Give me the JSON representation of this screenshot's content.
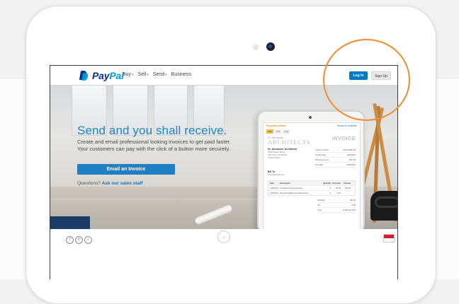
{
  "nav": {
    "logo_pay": "Pay",
    "logo_pal": "Pal",
    "links": [
      {
        "label": "Buy"
      },
      {
        "label": "Sell"
      },
      {
        "label": "Send"
      },
      {
        "label": "Business"
      }
    ],
    "login": "Log In",
    "signup": "Sign Up"
  },
  "hero": {
    "headline": "Send and you shall receive.",
    "sub1": "Create and email professional looking invoices to get paid faster.",
    "sub2": "Your customers can pay with the click of a button more securely.",
    "cta": "Email an Invoice",
    "questions": "Questions?",
    "questions_link": "Ask our sales staff"
  },
  "invoice": {
    "preview": "Preview Invoice",
    "save": "Saved Complete",
    "tabs": [
      "Web",
      "iOS",
      "iPad"
    ],
    "brand_small": "St. Alexander",
    "brand_big": "ARCHITECTS",
    "word": "INVOICE",
    "from_name": "St. Alexander Architects",
    "from_lines": [
      "3040 Aspen Street",
      "San Jose, CA 95131",
      "United States"
    ],
    "meta": [
      {
        "k": "Invoice number",
        "v": "0001-0000-00"
      },
      {
        "k": "Invoice date",
        "v": "1/26/2014"
      },
      {
        "k": "Payment terms",
        "v": "NET 30"
      },
      {
        "k": "Due date",
        "v": "2/25/2014"
      }
    ],
    "bill_to": "Bill To",
    "bill_email": "client@email.com",
    "item_head": [
      "Date",
      "Description",
      "Quantity",
      "Unit price",
      "Amount"
    ],
    "items": [
      [
        "1/26/2014",
        "Conditioner and setup fees",
        "3",
        "60.00",
        "180.00"
      ],
      [
        "1/26/2014",
        "Extended lighting kit maintenance",
        "1",
        "0.00",
        ""
      ]
    ],
    "totals": [
      {
        "k": "Subtotal",
        "v": "180.00"
      },
      {
        "k": "Tax",
        "v": "0.00"
      },
      {
        "k": "Total",
        "v": "$ 180.00 USD"
      }
    ]
  },
  "colors": {
    "accent": "#f08d2e",
    "paypal_blue": "#003087",
    "paypal_light": "#009cde",
    "cta_blue": "#1e7fc3"
  }
}
